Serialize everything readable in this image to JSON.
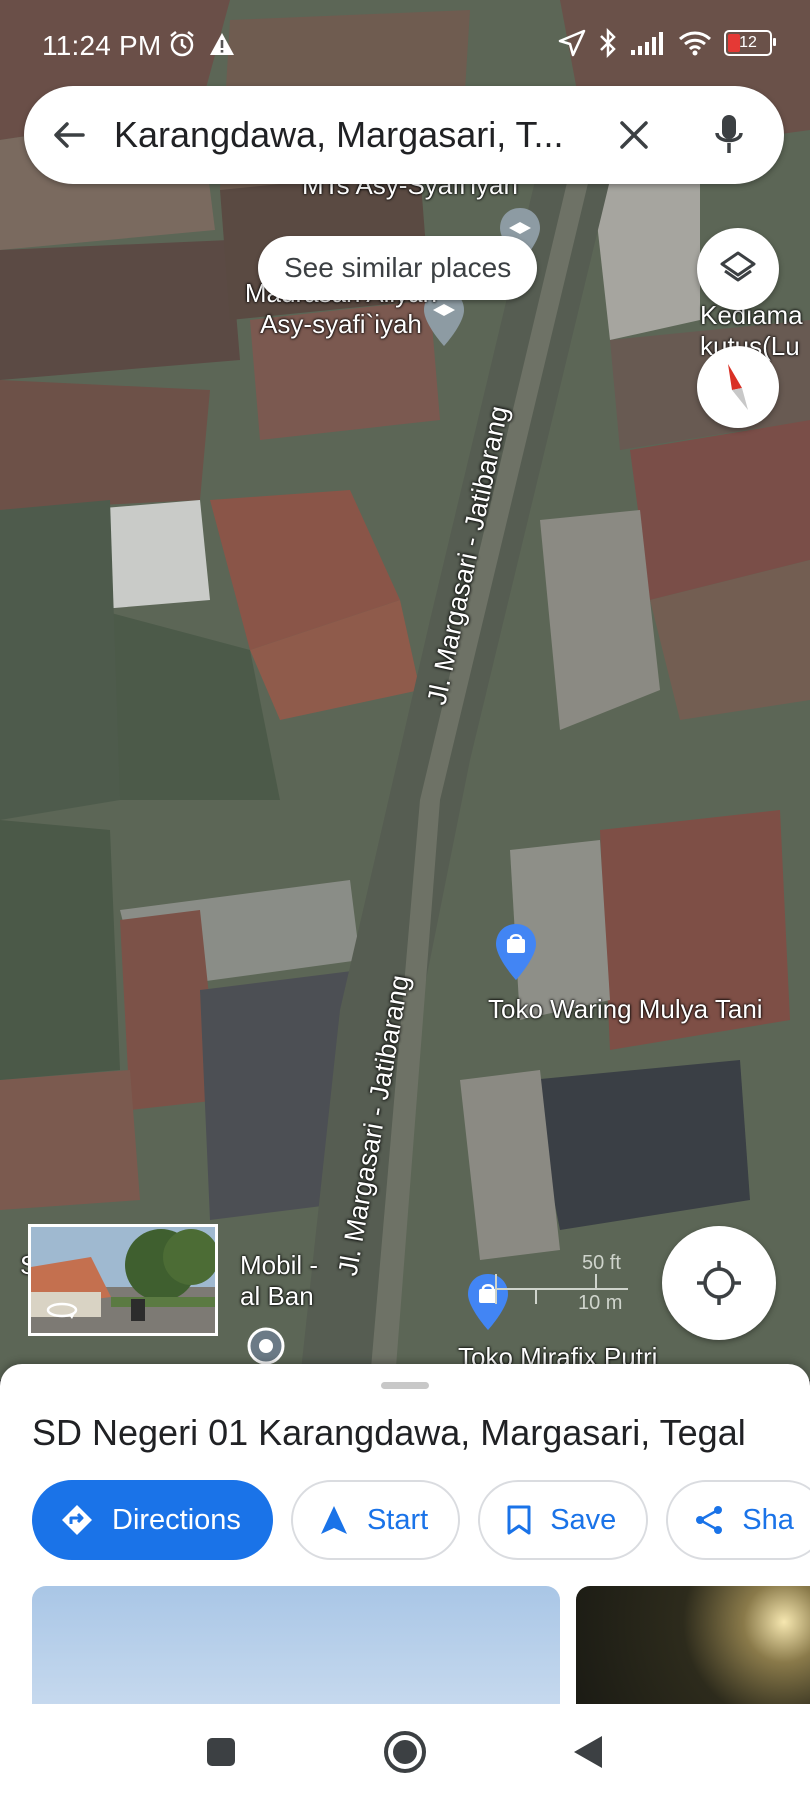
{
  "status_bar": {
    "time": "11:24 PM",
    "battery_level": "12",
    "icons_left": [
      "alarm-icon",
      "warning-icon"
    ],
    "icons_right": [
      "location-arrow-icon",
      "bluetooth-icon",
      "signal-icon",
      "wifi-icon",
      "battery-icon"
    ]
  },
  "search": {
    "query": "Karangdawa, Margasari, T...",
    "icons": [
      "back-arrow-icon",
      "clear-icon",
      "mic-icon"
    ]
  },
  "map": {
    "chip_label": "See similar places",
    "labels": {
      "mts": "MTs Asy-Syafi'iyah",
      "madrasah_line1": "Madrasah Aliyah",
      "madrasah_line2": "Asy-syafi`iyah",
      "kediaman_line1": "Kediama",
      "kediaman_line2": "kutus(Lu",
      "road_upper": "Jl. Margasari - Jatibarang",
      "road_lower": "Jl. Margasari - Jatibarang",
      "toko_waring": "Toko Waring Mulya Tani",
      "mobil_line1": "Mobil -",
      "mobil_line2": "al Ban",
      "s_prefix": "S",
      "toko_mirafix": "Toko Mirafix Putri"
    },
    "scale": {
      "feet": "50 ft",
      "meters": "10 m"
    },
    "colors": {
      "pin_blue": "#4285f4",
      "pin_gray": "#9aa0a6",
      "compass_red": "#d93025"
    }
  },
  "sheet": {
    "place_title": "SD Negeri 01 Karangdawa, Margasari, Tegal",
    "actions": [
      {
        "label": "Directions",
        "icon": "directions-icon"
      },
      {
        "label": "Start",
        "icon": "navigation-arrow-icon"
      },
      {
        "label": "Save",
        "icon": "bookmark-icon"
      },
      {
        "label": "Sha",
        "icon": "share-icon"
      }
    ],
    "accent": "#1a73e8"
  },
  "nav_bar": {
    "icons": [
      "recents-square-icon",
      "home-circle-icon",
      "back-triangle-icon"
    ]
  }
}
